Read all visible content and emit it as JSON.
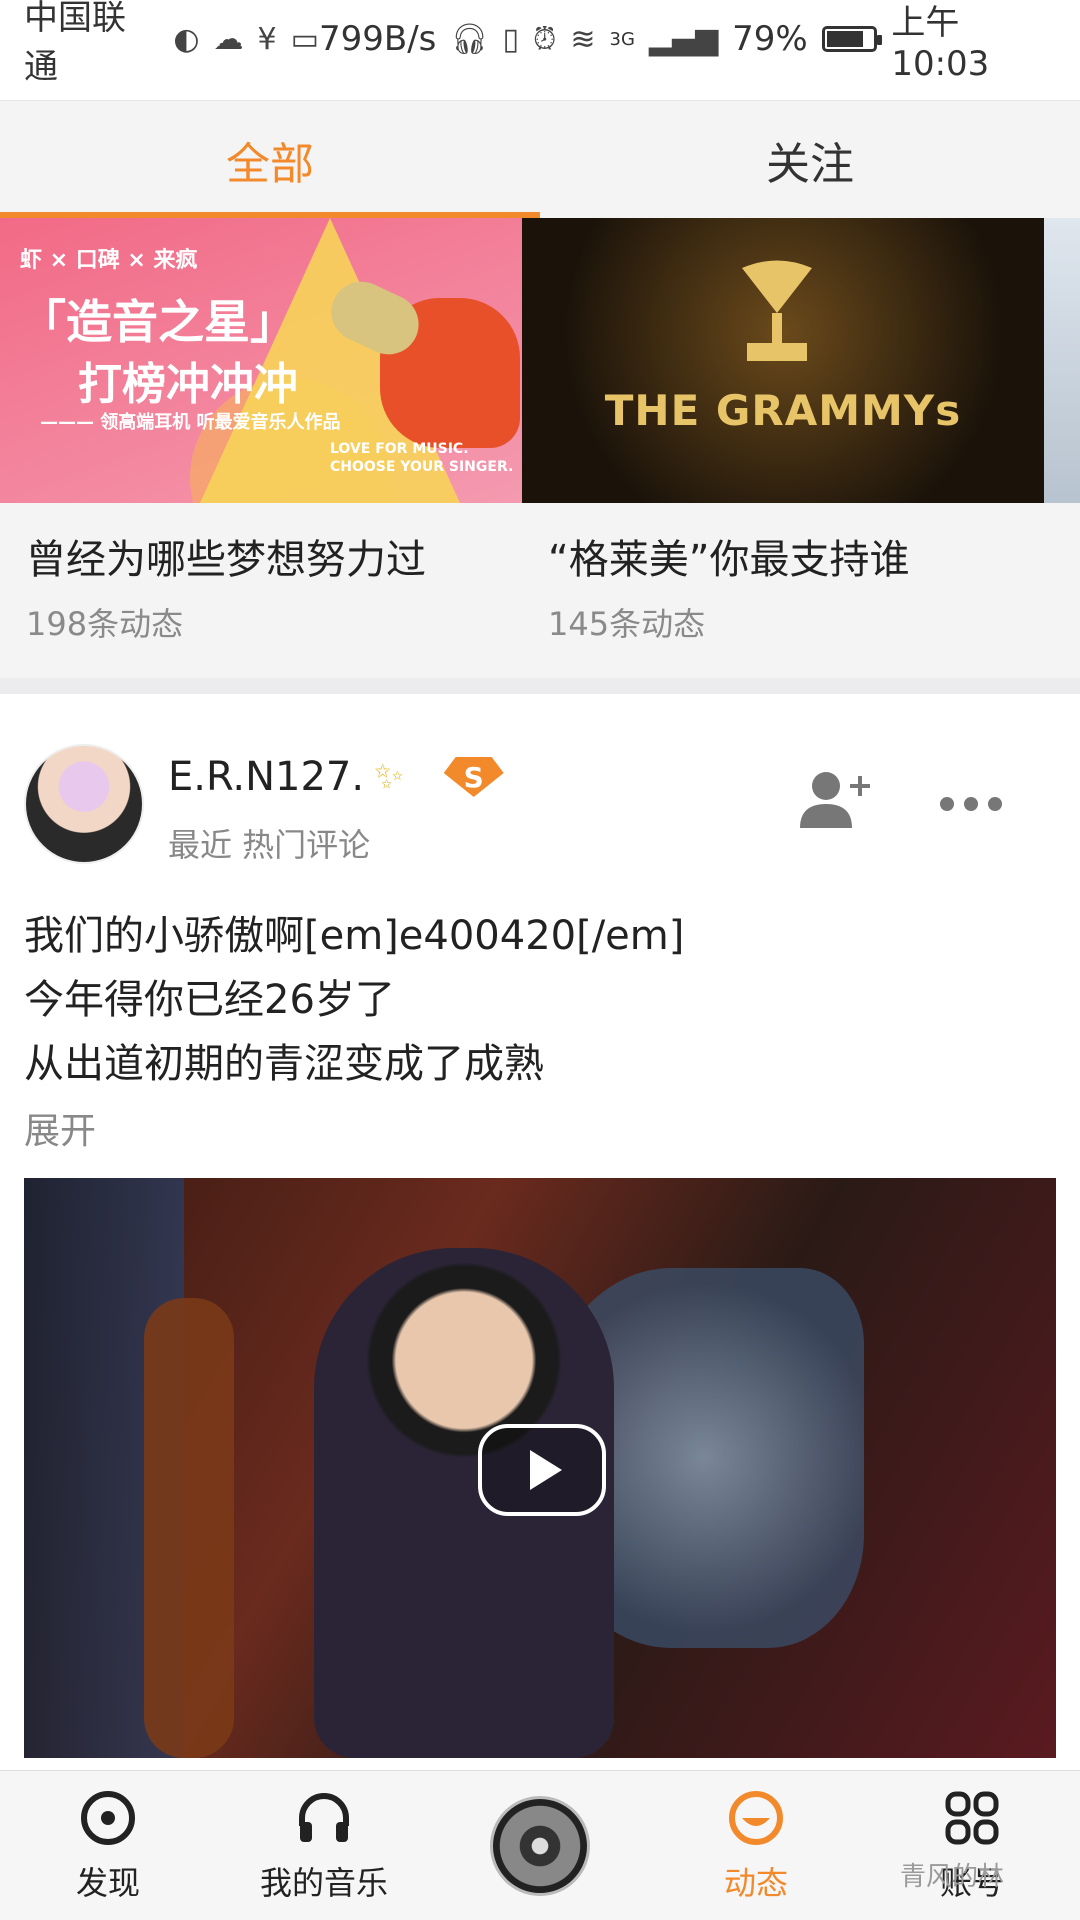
{
  "status_bar": {
    "carrier": "中国联通",
    "speed": "799B/s",
    "network": "3G",
    "battery": "79%",
    "battery_level": 0.79,
    "time": "上午10:03"
  },
  "tabs": [
    {
      "label": "全部",
      "active": true
    },
    {
      "label": "关注",
      "active": false
    }
  ],
  "topics": [
    {
      "title": "曾经为哪些梦想努力过",
      "count": "198条动态",
      "banner": {
        "brand": "虾 × 口碑 × 来疯",
        "line1": "「造音之星」",
        "line2": "打榜冲冲冲",
        "line3": "——— 领高端耳机 听最爱音乐人作品",
        "line4": "LOVE FOR MUSIC. CHOOSE YOUR SINGER."
      }
    },
    {
      "title": "“格莱美”你最支持谁",
      "count": "145条动态",
      "banner": {
        "text": "THE GRAMMYs"
      }
    },
    {
      "title": "",
      "count": "",
      "banner": {}
    }
  ],
  "post": {
    "username": "E.R.N127.",
    "badge": "S",
    "meta": "最近 热门评论",
    "lines": [
      "我们的小骄傲啊[em]e400420[/em]",
      "今年得你已经26岁了",
      "从出道初期的青涩变成了成熟"
    ],
    "expand": "展开"
  },
  "bottom_nav": [
    {
      "label": "发现",
      "icon": "discover-icon",
      "active": false
    },
    {
      "label": "我的音乐",
      "icon": "headphones-icon",
      "active": false
    },
    {
      "label": "",
      "icon": "now-playing-disc",
      "active": false
    },
    {
      "label": "动态",
      "icon": "feed-icon",
      "active": true
    },
    {
      "label": "账号",
      "icon": "account-grid-icon",
      "active": false
    }
  ],
  "watermark": "青风的林",
  "colors": {
    "accent": "#f28a2c",
    "background": "#ffffff",
    "tab_bar": "#f4f4f5"
  }
}
